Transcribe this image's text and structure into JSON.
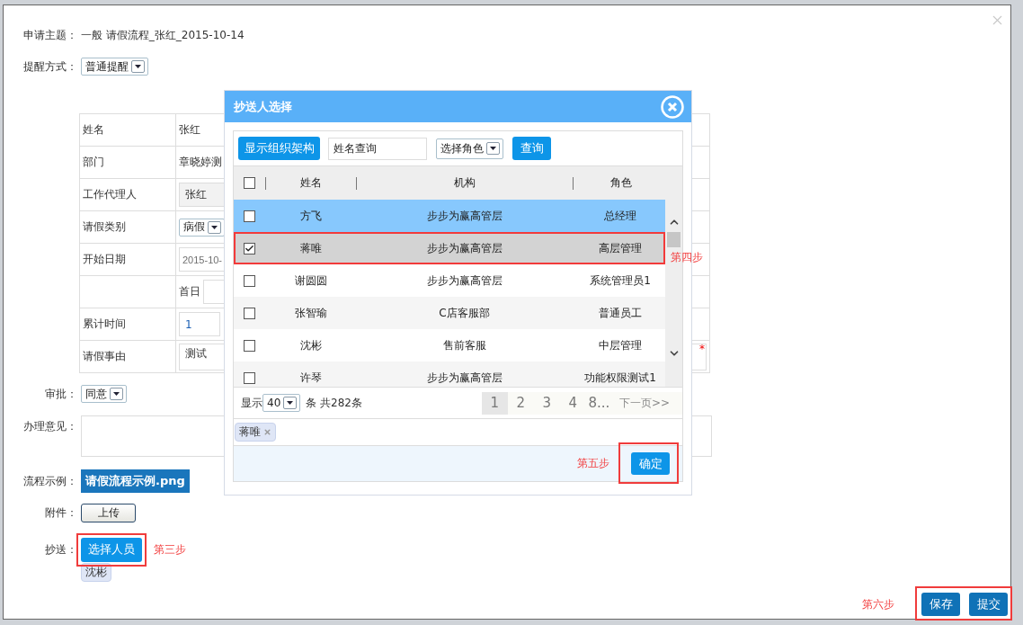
{
  "subject": {
    "label": "申请主题：",
    "value": "一般 请假流程_张红_2015-10-14"
  },
  "reminder": {
    "label": "提醒方式：",
    "value": "普通提醒"
  },
  "leave_table": [
    {
      "kind": "text",
      "label": "姓名",
      "value": "张红"
    },
    {
      "kind": "text",
      "label": "部门",
      "value": "章晓婷测"
    },
    {
      "kind": "input",
      "label": "工作代理人",
      "value": "张红"
    },
    {
      "kind": "select",
      "label": "请假类别",
      "value": "病假"
    },
    {
      "kind": "date",
      "label": "开始日期",
      "value": "2015-10-"
    },
    {
      "kind": "prefix",
      "value": "首日"
    },
    {
      "kind": "number",
      "label": "累计时间",
      "value": "1"
    },
    {
      "kind": "textarea",
      "label": "请假事由",
      "value": "测试",
      "required_mark": "*"
    }
  ],
  "approval": {
    "label": "审批：",
    "value": "同意"
  },
  "opinion": {
    "label": "办理意见："
  },
  "example": {
    "label": "流程示例：",
    "file": "请假流程示例.png"
  },
  "attachment": {
    "label": "附件：",
    "button": "上传"
  },
  "cc": {
    "label": "抄送：",
    "button": "选择人员",
    "step": "第三步",
    "chips": [
      "沈彬"
    ]
  },
  "footer": {
    "step": "第六步",
    "buttons": [
      "保存",
      "提交"
    ]
  },
  "dialog": {
    "title": "抄送人选择",
    "org_button": "显示组织架构",
    "search": {
      "value": "姓名查询"
    },
    "role_select": "选择角色",
    "query_button": "查询",
    "all_checked": false,
    "columns": [
      "姓名",
      "机构",
      "角色"
    ],
    "rows": [
      {
        "name": "方飞",
        "org": "步步为赢高管层",
        "role": "总经理",
        "checked": false,
        "selected": true,
        "annotated": false
      },
      {
        "name": "蒋唯",
        "org": "步步为赢高管层",
        "role": "高层管理",
        "checked": true,
        "selected": false,
        "annotated": true
      },
      {
        "name": "谢圆圆",
        "org": "步步为赢高管层",
        "role": "系统管理员1",
        "checked": false,
        "selected": false,
        "annotated": false
      },
      {
        "name": "张智瑜",
        "org": "C店客服部",
        "role": "普通员工",
        "checked": false,
        "selected": false,
        "annotated": false
      },
      {
        "name": "沈彬",
        "org": "售前客服",
        "role": "中层管理",
        "checked": false,
        "selected": false,
        "annotated": false
      },
      {
        "name": "许琴",
        "org": "步步为赢高管层",
        "role": "功能权限测试1",
        "checked": false,
        "selected": false,
        "annotated": false
      }
    ],
    "row_step": "第四步",
    "pager": {
      "show": "显示",
      "page_size": "40",
      "total": "条 共282条",
      "pages": [
        {
          "label": "1",
          "selected": true
        },
        {
          "label": "2",
          "selected": false
        },
        {
          "label": "3",
          "selected": false
        },
        {
          "label": "4",
          "selected": false
        },
        {
          "label": "8...",
          "selected": false
        }
      ],
      "next": "下一页>>"
    },
    "chips": [
      "蒋唯"
    ],
    "step": "第五步",
    "confirm": "确定"
  }
}
